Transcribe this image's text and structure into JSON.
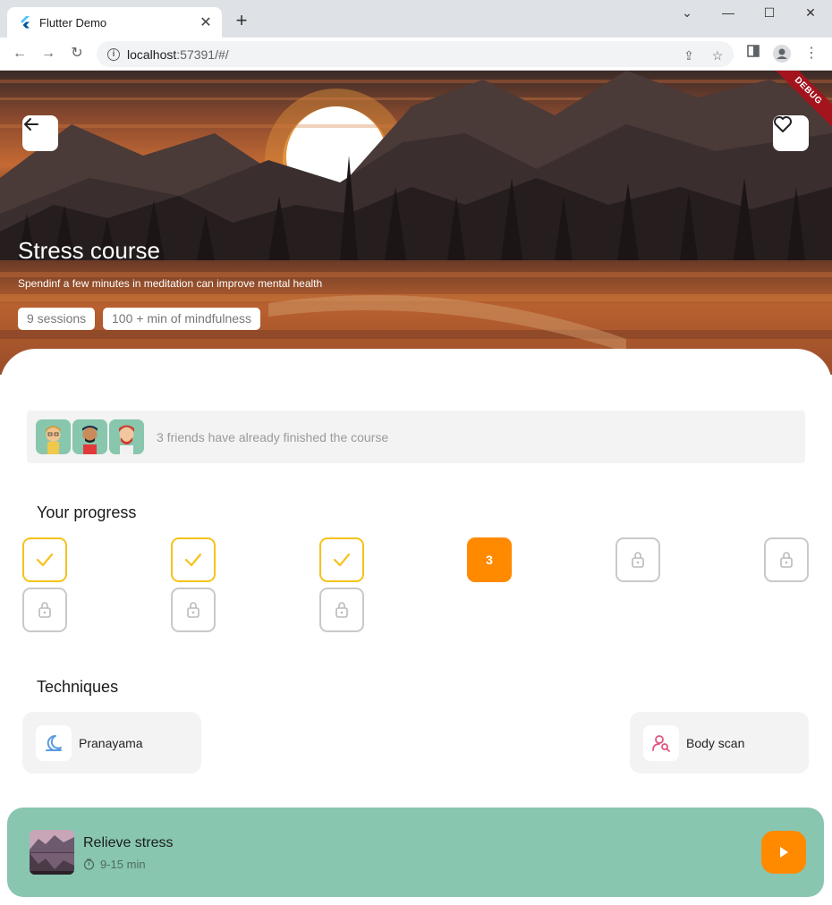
{
  "browser": {
    "tab_title": "Flutter Demo",
    "url_host": "localhost",
    "url_rest": ":57391/#/"
  },
  "hero": {
    "title": "Stress course",
    "subtitle": "Spendinf a few minutes in meditation can improve mental health",
    "chips": [
      "9 sessions",
      "100 + min of mindfulness"
    ],
    "debug_label": "DEBUG"
  },
  "friends": {
    "text": "3 friends have already finished the course"
  },
  "progress": {
    "title": "Your progress",
    "current_label": "3",
    "steps": [
      "done",
      "done",
      "done",
      "current",
      "locked",
      "locked",
      "locked",
      "locked",
      "locked"
    ]
  },
  "techniques": {
    "title": "Techniques",
    "items": [
      {
        "label": "Pranayama",
        "icon": "moon-icon"
      },
      {
        "label": "Body scan",
        "icon": "person-search-icon"
      }
    ]
  },
  "player": {
    "title": "Relieve stress",
    "duration": "9-15 min"
  },
  "colors": {
    "accent": "#ff8a00",
    "check": "#f6c21b",
    "player_bg": "#88c6b0",
    "debug": "#a3141d"
  }
}
